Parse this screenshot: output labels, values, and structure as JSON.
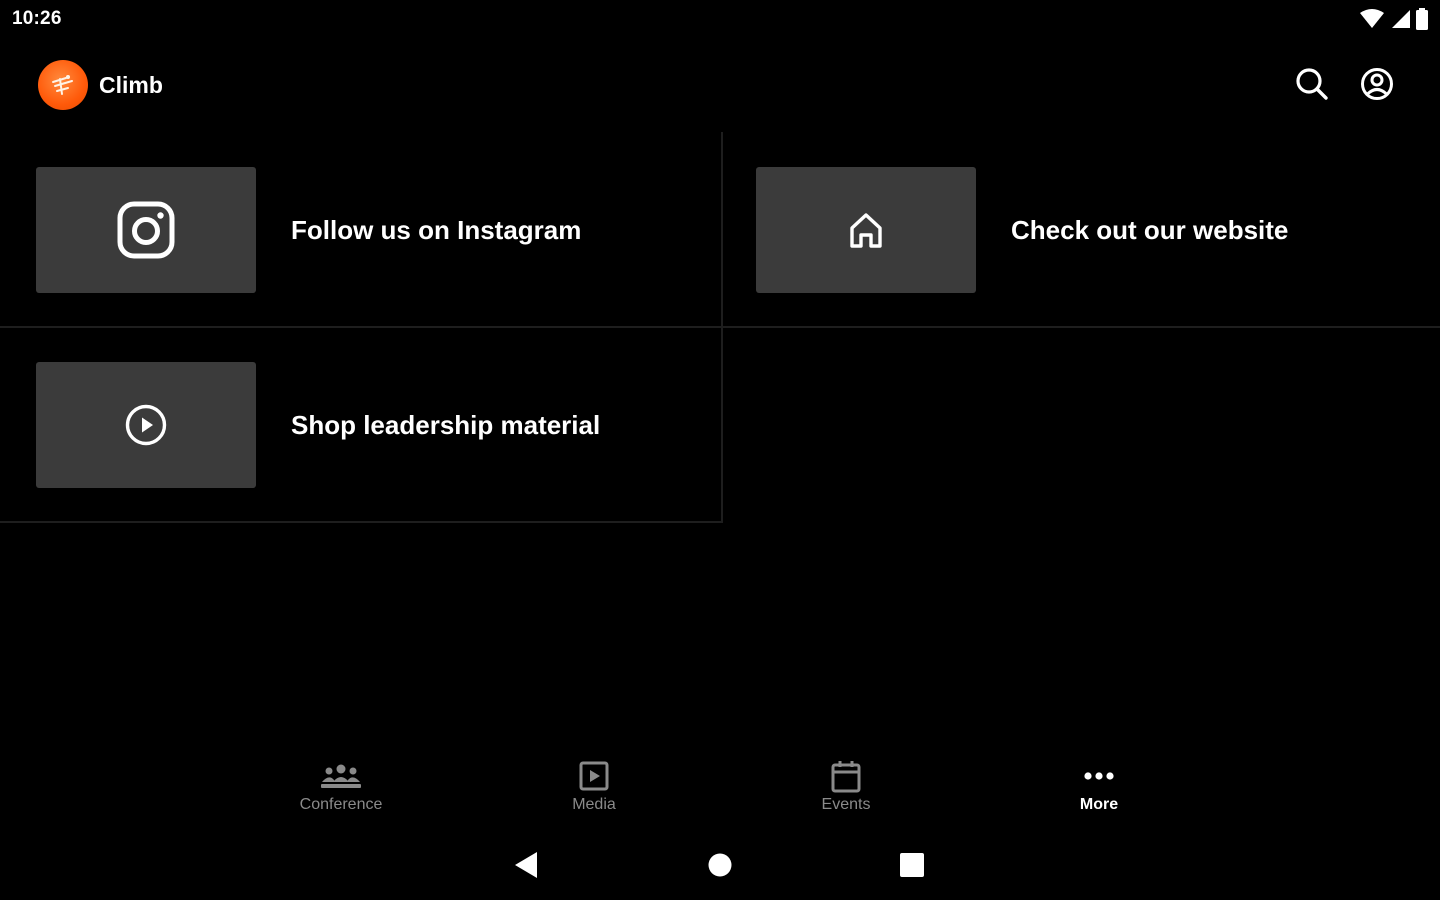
{
  "status_bar": {
    "time": "10:26",
    "icons": [
      "wifi-icon",
      "signal-icon",
      "battery-icon"
    ]
  },
  "app_bar": {
    "title": "Climb",
    "logo_icon": "climb-logo-icon",
    "actions": [
      "search-icon",
      "account-icon"
    ]
  },
  "tiles": [
    {
      "label": "Follow us on Instagram",
      "icon": "instagram-icon"
    },
    {
      "label": "Check out our website",
      "icon": "home-icon"
    },
    {
      "label": "Shop leadership material",
      "icon": "play-circle-icon"
    }
  ],
  "bottom_nav": {
    "items": [
      {
        "label": "Conference",
        "icon": "group-icon",
        "active": false
      },
      {
        "label": "Media",
        "icon": "media-icon",
        "active": false
      },
      {
        "label": "Events",
        "icon": "calendar-icon",
        "active": false
      },
      {
        "label": "More",
        "icon": "more-icon",
        "active": true
      }
    ]
  },
  "system_nav": [
    "back-icon",
    "home-circle-icon",
    "recents-icon"
  ],
  "colors": {
    "background": "#000000",
    "tile_thumb": "#3b3b3b",
    "logo": "#ff5a0a",
    "inactive_label": "#8a8a8a",
    "active_label": "#ffffff"
  }
}
